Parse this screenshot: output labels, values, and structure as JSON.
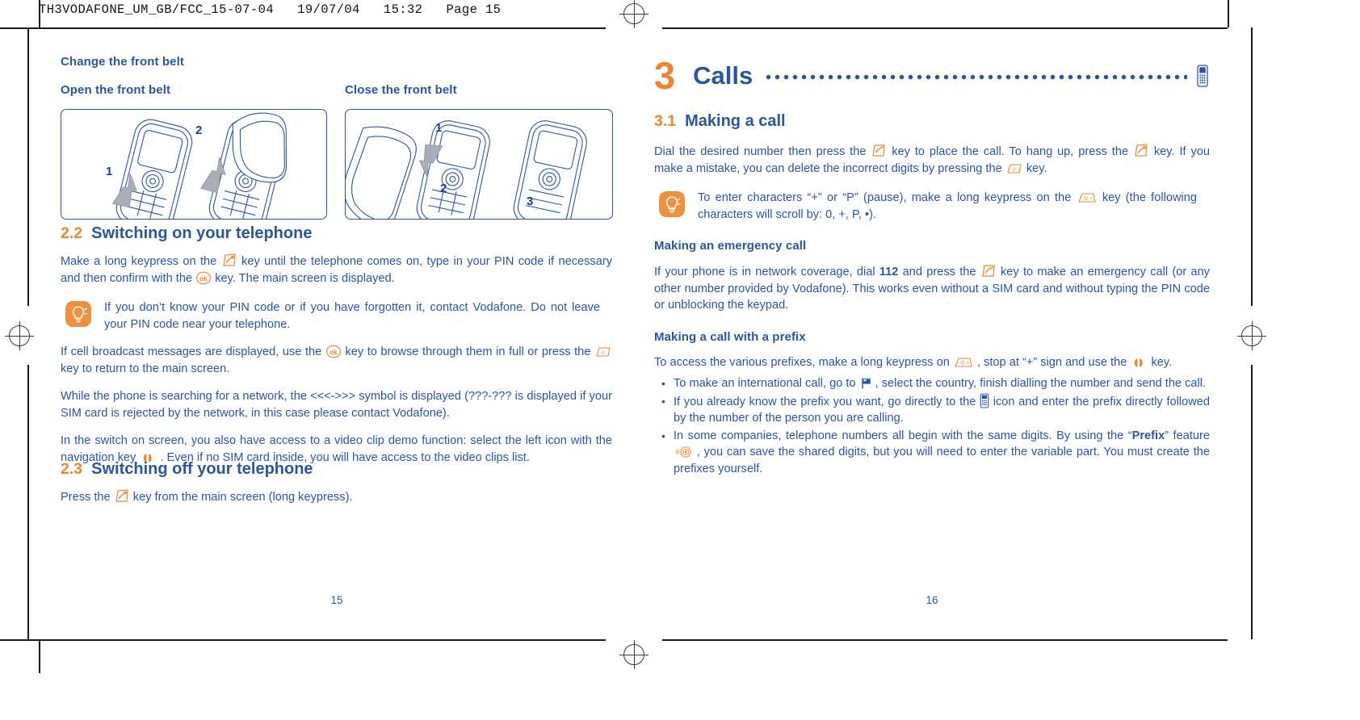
{
  "print_marks": {
    "running_head": "TH3VODAFONE_UM_GB/FCC_15-07-04   19/07/04   15:32   Page 15"
  },
  "colors": {
    "brand_blue": "#2b55a0",
    "accent_orange": "#ee8631",
    "tip_orange": "#f0913f",
    "arrow_gray": "#a9aeb8"
  },
  "left_page": {
    "folio": "15",
    "heading": "Change the front belt",
    "figures": [
      {
        "caption": "Open the front belt",
        "name": "open-front-belt-figure",
        "callouts": [
          "1",
          "2"
        ]
      },
      {
        "caption": "Close the front belt",
        "name": "close-front-belt-figure",
        "callouts": [
          "1",
          "2",
          "3"
        ]
      }
    ],
    "section_22": {
      "number": "2.2",
      "title": "Switching on your telephone",
      "p1_a": "Make a long keypress on the",
      "p1_b": "key until the telephone comes on, type in your PIN code if necessary and then confirm with the",
      "p1_c": "key. The main screen is displayed.",
      "tip": "If you don’t know your PIN code or if you have forgotten it, contact Vodafone. Do not leave your PIN code near your telephone.",
      "p2_a": "If cell broadcast messages are displayed, use the",
      "p2_b": "key to browse through them in full or press the",
      "p2_c": "key to return to the main screen.",
      "p3": "While the phone is searching for a network, the <<<->>> symbol is displayed (???-??? is displayed if your SIM card is rejected by the network, in this case please contact Vodafone).",
      "p4_a": "In the switch on screen, you also have access to a video clip demo function: select the left icon with the navigation key",
      "p4_b": ". Even if no SIM card inside, you will have access to the video clips list."
    },
    "section_23": {
      "number": "2.3",
      "title": "Switching off your telephone",
      "p1_a": "Press the",
      "p1_b": "key from the main screen (long keypress)."
    }
  },
  "right_page": {
    "folio": "16",
    "chapter": {
      "number": "3",
      "title": "Calls"
    },
    "section_31": {
      "number": "3.1",
      "title": "Making a call",
      "p1_a": "Dial the desired number then press the",
      "p1_b": "key to place the call. To hang up, press the",
      "p1_c": "key. If you make a mistake, you can delete the incorrect digits by pressing the",
      "p1_d": "key.",
      "tip_a": "To enter characters “+” or “P” (pause), make a long keypress on the",
      "tip_b": "key (the following characters will scroll by: 0, +, P, •)."
    },
    "emergency": {
      "title": "Making an emergency call",
      "p_a": "If your phone is in network coverage, dial",
      "p_number": "112",
      "p_b": "and press the",
      "p_c": "key to make an emergency call (or any other number provided by Vodafone). This works even without a SIM card and without typing the PIN code or unblocking the keypad."
    },
    "prefix": {
      "title": "Making a call with a prefix",
      "intro_a": "To access the various prefixes, make a long keypress on",
      "intro_b": ", stop at “+” sign and use the",
      "intro_c": "key.",
      "bullets": [
        {
          "a": "To make an international call, go to",
          "b": ", select the country, finish dialling the number and send the call.",
          "icon": "flag-icon"
        },
        {
          "a": "If you already know the prefix you want, go directly to the",
          "b": "icon and enter the prefix directly followed by the number of the person you are calling.",
          "icon": "handset-icon"
        },
        {
          "a": "In some companies, telephone numbers all begin with the same digits. By using the “",
          "bold": "Prefix",
          "b": "” feature",
          "c": ", you can save the shared digits, but you will need to enter the variable part. You must create the prefixes yourself.",
          "icon": "hash-key-icon"
        }
      ]
    }
  }
}
